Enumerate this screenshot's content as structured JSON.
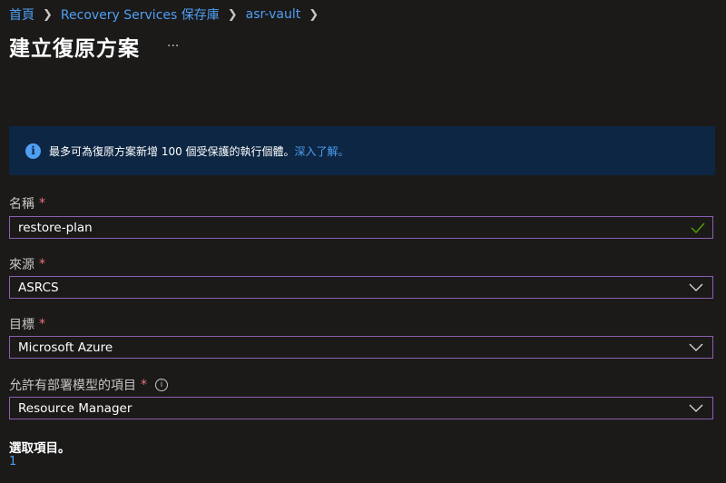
{
  "breadcrumb": [
    {
      "label": "首頁"
    },
    {
      "label": "Recovery Services 保存庫"
    },
    {
      "label": "asr-vault"
    }
  ],
  "page": {
    "title": "建立復原方案",
    "more_label": "···"
  },
  "info_banner": {
    "text": "最多可為復原方案新增 100 個受保護的執行個體。",
    "link": "深入了解。"
  },
  "form": {
    "name": {
      "label": "名稱",
      "required_mark": "*",
      "value": "restore-plan",
      "valid": true
    },
    "source": {
      "label": "來源",
      "required_mark": "*",
      "value": "ASRCS"
    },
    "target": {
      "label": "目標",
      "required_mark": "*",
      "value": "Microsoft Azure"
    },
    "deployment_model": {
      "label": "允許有部署模型的項目",
      "required_mark": "*",
      "info": "i",
      "value": "Resource Manager"
    }
  },
  "selection": {
    "label": "選取項目。",
    "count": "1"
  },
  "colors": {
    "background": "#1b1a19",
    "link": "#4f9ff3",
    "banner_bg": "#0c2643",
    "required": "#f1707b",
    "field_border": "#8a5fb0",
    "valid_check": "#57a300"
  }
}
